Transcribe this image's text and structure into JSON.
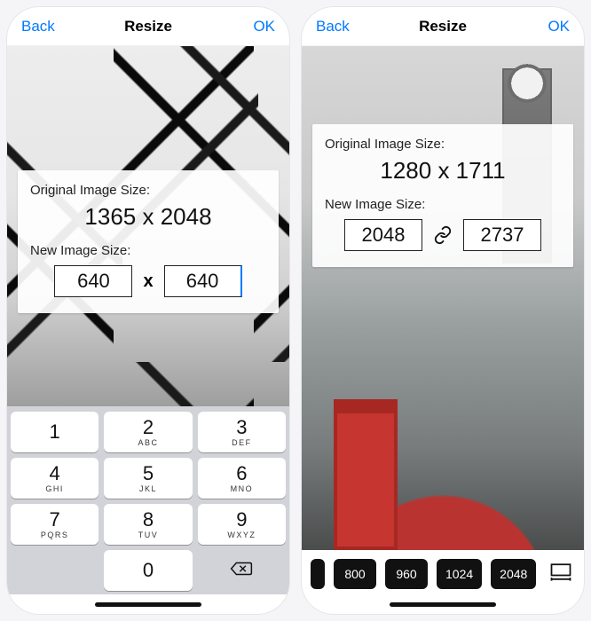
{
  "left": {
    "nav": {
      "back": "Back",
      "title": "Resize",
      "ok": "OK"
    },
    "original_label": "Original Image Size:",
    "original_size": "1365 x 2048",
    "new_label": "New Image Size:",
    "width": "640",
    "height": "640",
    "separator": "x",
    "keypad": {
      "k1": {
        "d": "1",
        "s": ""
      },
      "k2": {
        "d": "2",
        "s": "ABC"
      },
      "k3": {
        "d": "3",
        "s": "DEF"
      },
      "k4": {
        "d": "4",
        "s": "GHI"
      },
      "k5": {
        "d": "5",
        "s": "JKL"
      },
      "k6": {
        "d": "6",
        "s": "MNO"
      },
      "k7": {
        "d": "7",
        "s": "PQRS"
      },
      "k8": {
        "d": "8",
        "s": "TUV"
      },
      "k9": {
        "d": "9",
        "s": "WXYZ"
      },
      "k0": {
        "d": "0",
        "s": ""
      }
    }
  },
  "right": {
    "nav": {
      "back": "Back",
      "title": "Resize",
      "ok": "OK"
    },
    "original_label": "Original Image Size:",
    "original_size": "1280 x 1711",
    "new_label": "New Image Size:",
    "width": "2048",
    "height": "2737",
    "presets": [
      "800",
      "960",
      "1024",
      "2048"
    ]
  }
}
